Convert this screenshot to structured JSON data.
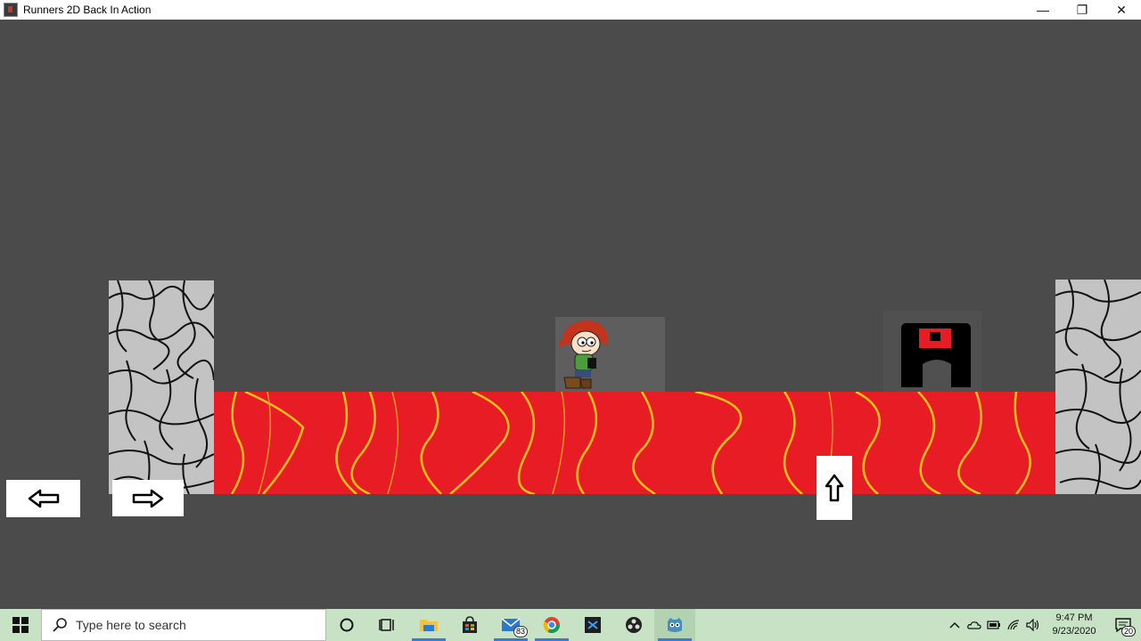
{
  "window": {
    "title": "Runners 2D Back In Action",
    "minimize_glyph": "—",
    "maximize_glyph": "❐",
    "close_glyph": "✕"
  },
  "game": {
    "background_color": "#4b4b4b",
    "lava_color": "#e81c24",
    "stone_color": "#c3c3c3",
    "controls": {
      "left_label": "⇦",
      "right_label": "⇨",
      "jump_label": "⇧"
    }
  },
  "taskbar": {
    "search_placeholder": "Type here to search",
    "mail_badge": "83",
    "clock_time": "9:47 PM",
    "clock_date": "9/23/2020",
    "notification_count": "20",
    "apps": [
      "cortana-icon",
      "task-view-icon",
      "file-explorer-icon",
      "store-icon",
      "mail-icon",
      "chrome-icon",
      "vs-icon",
      "obs-icon",
      "godot-icon"
    ]
  }
}
